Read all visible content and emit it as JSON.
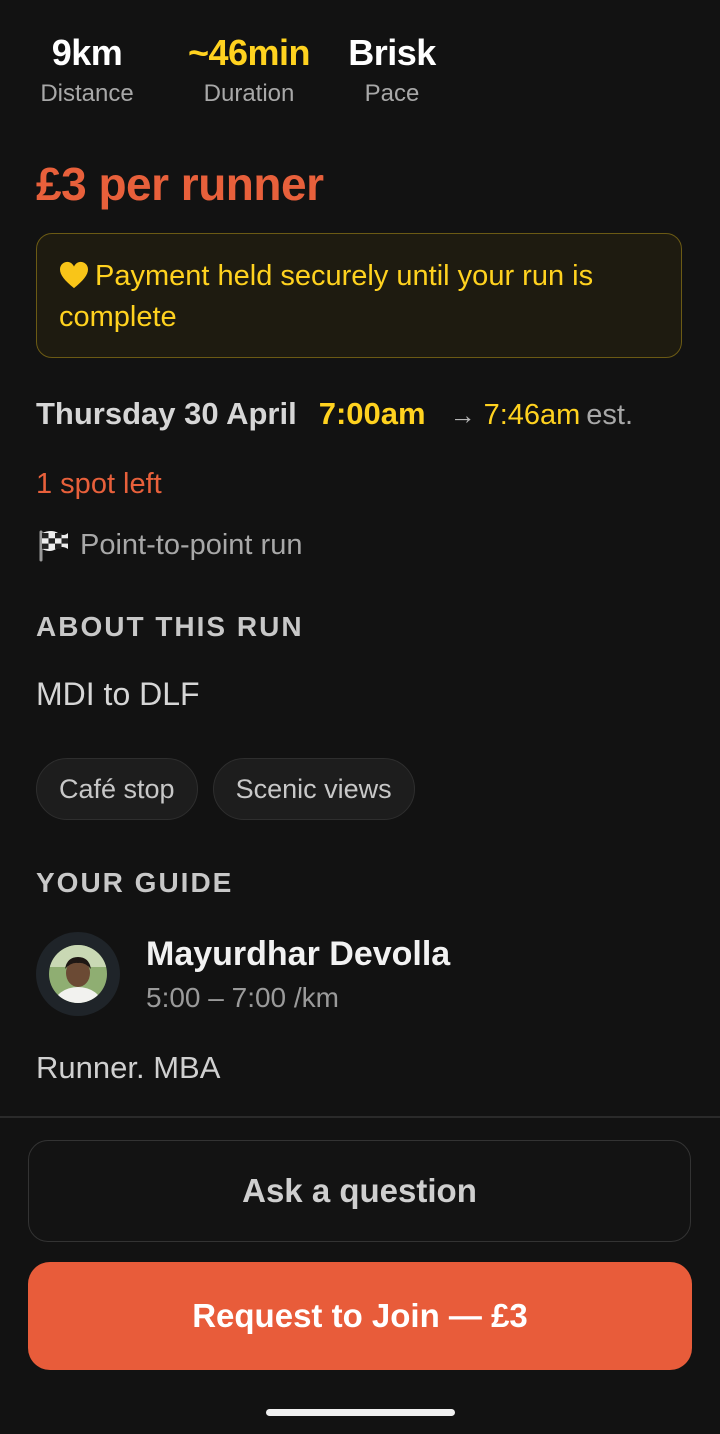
{
  "stats": [
    {
      "value": "9km",
      "label": "Distance"
    },
    {
      "value": "~46min",
      "label": "Duration"
    },
    {
      "value": "Brisk",
      "label": "Pace"
    }
  ],
  "price": "£3 per runner",
  "payment_notice": "Payment held securely until your run is complete",
  "schedule": {
    "date": "Thursday 30 April",
    "start_time": "7:00am",
    "arrow": "→",
    "end_time": "7:46am",
    "end_suffix": "est."
  },
  "spots_left": "1 spot left",
  "route_type": "Point-to-point run",
  "about": {
    "title": "ABOUT THIS RUN",
    "text": "MDI to DLF",
    "tags": [
      "Café stop",
      "Scenic views"
    ]
  },
  "guide": {
    "title": "YOUR GUIDE",
    "name": "Mayurdhar Devolla",
    "pace": "5:00 – 7:00 /km",
    "bio": "Runner. MBA"
  },
  "actions": {
    "ask_label": "Ask a question",
    "join_label": "Request to Join — £3"
  },
  "colors": {
    "accent_orange": "#e85c3a",
    "accent_yellow": "#ffd21f",
    "background": "#121212"
  },
  "icons": {
    "notice": "yellow-heart-icon",
    "route": "checkered-flag-icon"
  }
}
